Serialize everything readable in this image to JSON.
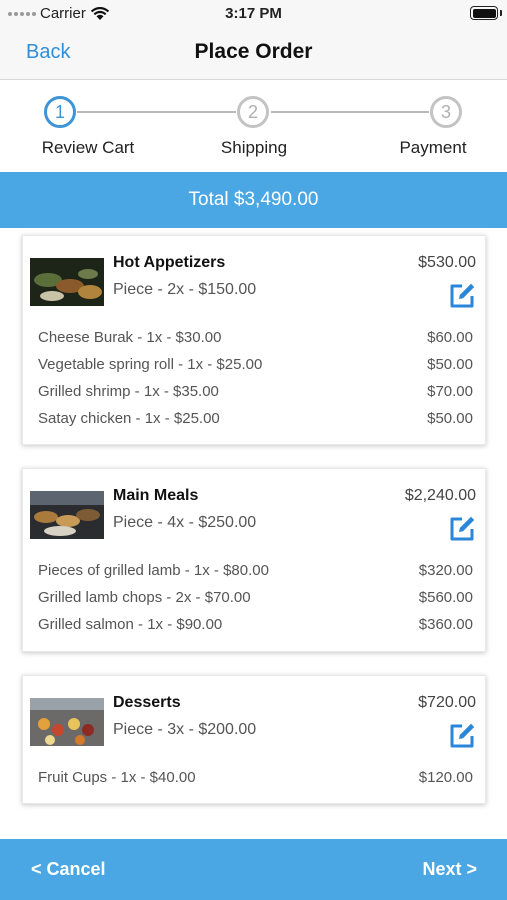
{
  "status_bar": {
    "carrier": "Carrier",
    "time": "3:17 PM"
  },
  "nav": {
    "back_label": "Back",
    "title": "Place Order"
  },
  "steps": [
    {
      "number": "1",
      "label": "Review Cart"
    },
    {
      "number": "2",
      "label": "Shipping"
    },
    {
      "number": "3",
      "label": "Payment"
    }
  ],
  "total": "Total $3,490.00",
  "cards": [
    {
      "name": "Hot Appetizers",
      "price": "$530.00",
      "subtitle": "Piece - 2x - $150.00",
      "items": [
        {
          "label": "Cheese Burak - 1x - $30.00",
          "amount": "$60.00"
        },
        {
          "label": "Vegetable spring roll - 1x - $25.00",
          "amount": "$50.00"
        },
        {
          "label": "Grilled shrimp - 1x - $35.00",
          "amount": "$70.00"
        },
        {
          "label": "Satay chicken - 1x - $25.00",
          "amount": "$50.00"
        }
      ]
    },
    {
      "name": "Main Meals",
      "price": "$2,240.00",
      "subtitle": "Piece - 4x - $250.00",
      "items": [
        {
          "label": "Pieces of grilled lamb - 1x - $80.00",
          "amount": "$320.00"
        },
        {
          "label": "Grilled lamb chops - 2x - $70.00",
          "amount": "$560.00"
        },
        {
          "label": "Grilled salmon - 1x - $90.00",
          "amount": "$360.00"
        }
      ]
    },
    {
      "name": "Desserts",
      "price": "$720.00",
      "subtitle": "Piece - 3x - $200.00",
      "items": [
        {
          "label": "Fruit Cups - 1x - $40.00",
          "amount": "$120.00"
        }
      ]
    }
  ],
  "footer": {
    "cancel_label": "< Cancel",
    "next_label": "Next >"
  },
  "colors": {
    "accent": "#4aa7e3",
    "link": "#2f8fd8",
    "edit_icon": "#2a86d8"
  },
  "icons": {
    "edit": "edit-square-pen-icon",
    "wifi": "wifi-icon",
    "battery": "battery-icon"
  }
}
